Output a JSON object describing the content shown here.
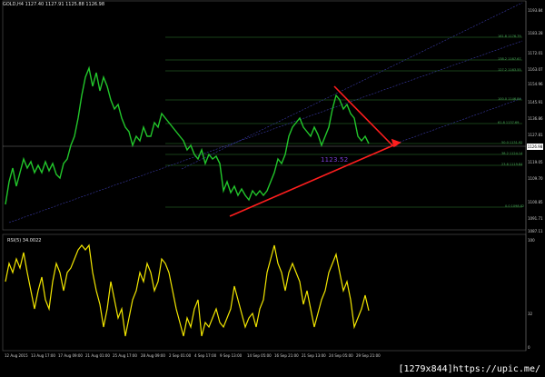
{
  "chart_window": {
    "symbol_header": "GOLD,H4 1127.40 1127.91 1125.88 1126.98",
    "current_price": "1126.98",
    "annotation": "1123.52",
    "rsi_header": "RSI(5) 34.0022",
    "price_ticks": [
      "1193.84",
      "1183.28",
      "1172.01",
      "1163.07",
      "1154.96",
      "1145.91",
      "1136.86",
      "1127.81",
      "1119.05",
      "1109.70",
      "1100.85",
      "1091.71",
      "1087.11"
    ],
    "rsi_ticks": [
      "100",
      "32",
      "0"
    ],
    "date_ticks": [
      "12 Aug 2015",
      "13 Aug 17:00",
      "17 Aug 09:00",
      "21 Aug 01:00",
      "25 Aug 17:00",
      "28 Aug 09:00",
      "2 Sep 01:00",
      "4 Sep 17:00",
      "9 Sep 13:00",
      "14 Sep 05:00",
      "16 Sep 21:00",
      "21 Sep 13:00",
      "24 Sep 05:00",
      "29 Sep 21:00"
    ],
    "fib_labels": [
      "161.8  1176.79",
      "138.2  1167.67",
      "127.2  1163.55",
      "100.0  1146.84",
      "61.8  1137.69",
      "50.0  1131.92",
      "38.2  1124.14",
      "23.6  1119.84",
      "0.0  1098.82"
    ],
    "colors": {
      "background": "#000000",
      "candles": "#22c62b",
      "rsi_line": "#f2e600",
      "trend_red": "#ff1e1e",
      "fib": "#2f7f2f",
      "channel": "#3a3aa8"
    }
  },
  "watermark": "[1279x844]https://upic.me/"
}
